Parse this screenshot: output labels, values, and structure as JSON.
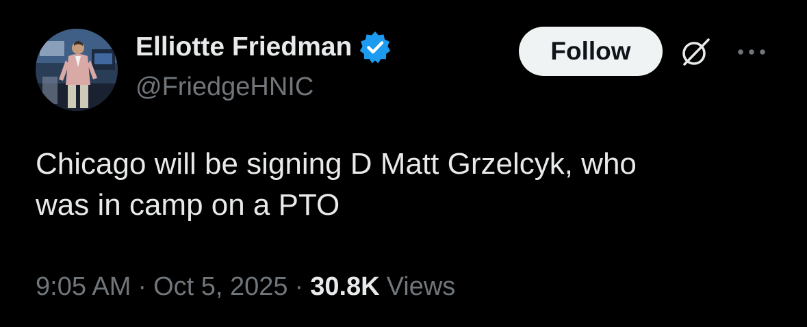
{
  "author": {
    "display_name": "Elliotte Friedman",
    "handle": "@FriedgeHNIC",
    "verified": true,
    "verified_color": "#1d9bf0"
  },
  "actions": {
    "follow_label": "Follow",
    "grok_icon": "grok-icon",
    "more_icon": "more-icon"
  },
  "tweet": {
    "text": "Chicago will be signing D Matt Grzelcyk, who\nwas in camp on a PTO"
  },
  "meta": {
    "time": "9:05 AM",
    "separator": "·",
    "date": "Oct 5, 2025",
    "views_count": "30.8K",
    "views_label": "Views"
  },
  "colors": {
    "background": "#000000",
    "primary_text": "#e7e9ea",
    "secondary_text": "#71767b",
    "follow_bg": "#eff3f4",
    "follow_text": "#0f1419"
  }
}
